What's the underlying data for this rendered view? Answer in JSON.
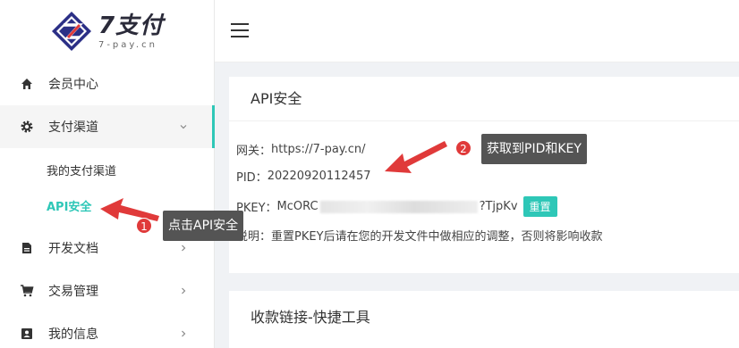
{
  "brand": {
    "title": "7支付",
    "subtitle": "7-pay.cn"
  },
  "sidebar": {
    "items": [
      {
        "label": "会员中心",
        "icon": "home-icon"
      },
      {
        "label": "支付渠道",
        "icon": "gear-icon",
        "expanded": true
      },
      {
        "label": "开发文档",
        "icon": "document-icon"
      },
      {
        "label": "交易管理",
        "icon": "cart-icon"
      },
      {
        "label": "我的信息",
        "icon": "id-card-icon"
      }
    ],
    "sub_items": [
      {
        "label": "我的支付渠道",
        "active": false
      },
      {
        "label": "API安全",
        "active": true
      }
    ]
  },
  "api_card": {
    "title": "API安全",
    "gateway_label": "网关：",
    "gateway_value": "https://7-pay.cn/",
    "pid_label": "PID：",
    "pid_value": "20220920112457",
    "pkey_label": "PKEY：",
    "pkey_prefix": "McORC",
    "pkey_suffix": "?TjpKv",
    "reset_label": "重置",
    "note_label": "说明：",
    "note_text": "重置PKEY后请在您的开发文件中做相应的调整，否则将影响收款"
  },
  "links_card": {
    "title": "收款链接-快捷工具"
  },
  "annotations": [
    {
      "num": "1",
      "text": "点击API安全"
    },
    {
      "num": "2",
      "text": "获取到PID和KEY"
    }
  ],
  "colors": {
    "accent": "#2ec7b7",
    "callout_bg": "#545454",
    "badge": "#e03a3a"
  }
}
